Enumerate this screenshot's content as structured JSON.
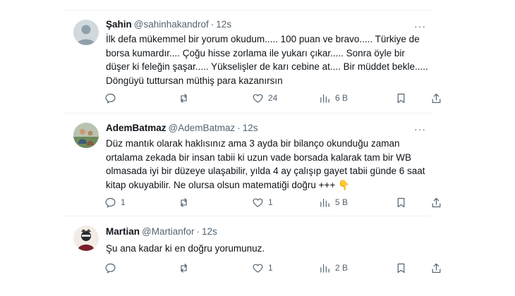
{
  "tweets": [
    {
      "name": "Şahin",
      "handle": "@sahinhakandrof",
      "separator": "·",
      "time": "12s",
      "text": "İlk defa mükemmel bir yorum okudum..... 100 puan ve bravo..... Türkiye de borsa kumardır.... Çoğu hisse zorlama ile yukarı çıkar..... Sonra öyle bir düşer ki feleğin şaşar..... Yükselişler de karı cebine at.... Bir müddet bekle..... Döngüyü tuttursan müthiş para kazanırsın",
      "counts": {
        "reply": "",
        "retweet": "",
        "like": "24",
        "views": "6 B"
      },
      "avatar": "default"
    },
    {
      "name": "AdemBatmaz",
      "handle": "@AdemBatmaz",
      "separator": "·",
      "time": "12s",
      "text": "Düz mantık olarak haklısınız ama 3 ayda bir bilanço okunduğu zaman ortalama zekada bir insan tabii ki uzun vade borsada kalarak tam bir WB olmasada iyi bir düzeye ulaşabilir, yılda 4 ay çalışıp gayet tabii günde 6 saat kitap okuyabilir. Ne olursa olsun matematiği doğru +++ 👇",
      "counts": {
        "reply": "1",
        "retweet": "",
        "like": "1",
        "views": "5 B"
      },
      "avatar": "photo"
    },
    {
      "name": "Martian",
      "handle": "@Martianfor",
      "separator": "·",
      "time": "12s",
      "text": "Şu ana kadar ki en doğru yorumunuz.",
      "counts": {
        "reply": "",
        "retweet": "",
        "like": "1",
        "views": "2 B"
      },
      "avatar": "character"
    }
  ],
  "more_glyph": "···",
  "colors": {
    "text": "#0f1419",
    "secondary": "#536471",
    "divider": "#eff3f4"
  },
  "icons": [
    "reply-icon",
    "retweet-icon",
    "like-icon",
    "views-icon",
    "bookmark-icon",
    "share-icon",
    "more-icon"
  ]
}
